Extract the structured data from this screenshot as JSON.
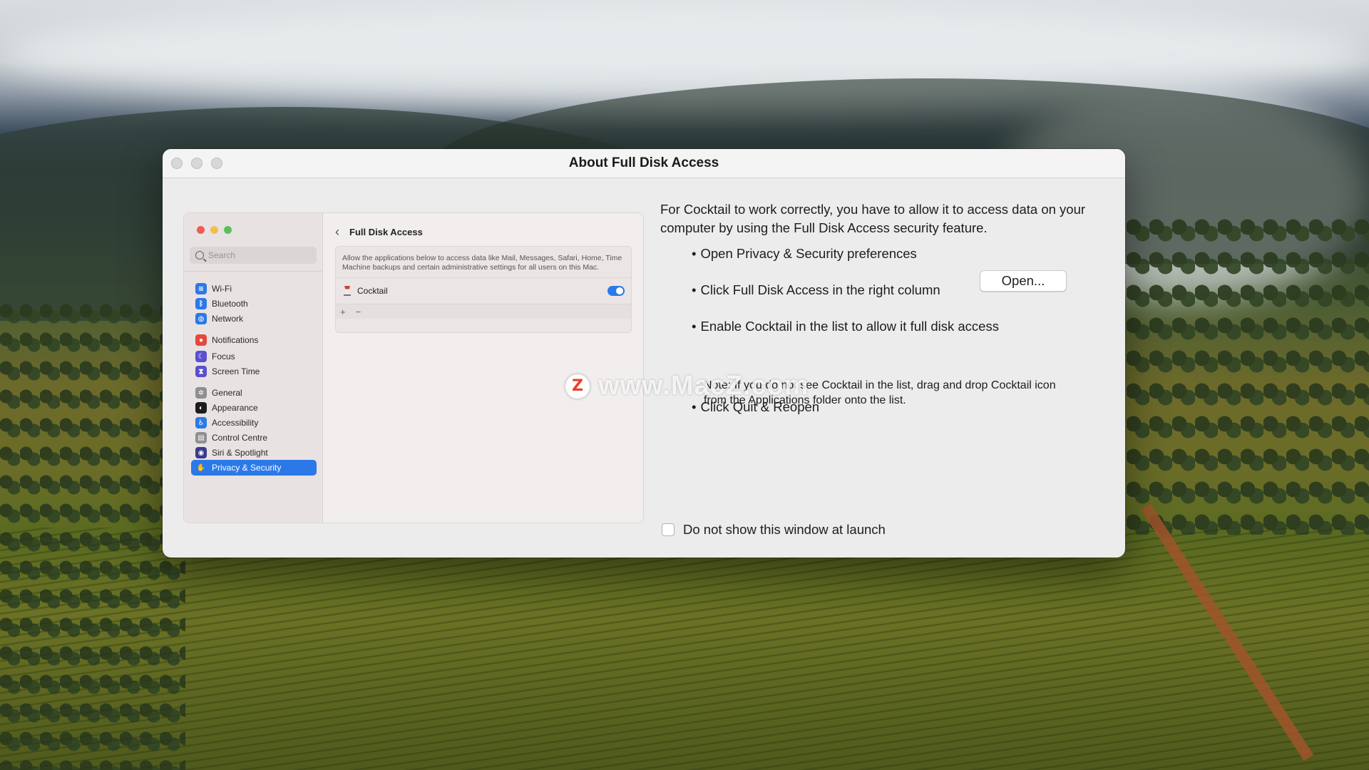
{
  "window": {
    "title": "About Full Disk Access"
  },
  "embedded_settings": {
    "search_placeholder": "Search",
    "header_title": "Full Disk Access",
    "panel_description": "Allow the applications below to access data like Mail, Messages, Safari, Home, Time Machine backups and certain administrative settings for all users on this Mac.",
    "app_row": {
      "name": "Cocktail",
      "enabled": true
    },
    "add_symbol": "+",
    "remove_symbol": "−",
    "sidebar": [
      {
        "label": "Wi-Fi",
        "icon": "wifi-icon",
        "color": "#2b79e8"
      },
      {
        "label": "Bluetooth",
        "icon": "bluetooth-icon",
        "color": "#2b79e8"
      },
      {
        "label": "Network",
        "icon": "globe-icon",
        "color": "#2b79e8"
      },
      {
        "label": "Notifications",
        "icon": "bell-icon",
        "color": "#e5483e"
      },
      {
        "label": "Focus",
        "icon": "moon-icon",
        "color": "#5a4fcf"
      },
      {
        "label": "Screen Time",
        "icon": "hourglass-icon",
        "color": "#5a4fcf"
      },
      {
        "label": "General",
        "icon": "gear-icon",
        "color": "#8e8e93"
      },
      {
        "label": "Appearance",
        "icon": "appearance-icon",
        "color": "#1c1c1e"
      },
      {
        "label": "Accessibility",
        "icon": "accessibility-icon",
        "color": "#2b79e8"
      },
      {
        "label": "Control Centre",
        "icon": "control-centre-icon",
        "color": "#8e8e93"
      },
      {
        "label": "Siri & Spotlight",
        "icon": "siri-icon",
        "color": "#3a3a8c"
      },
      {
        "label": "Privacy & Security",
        "icon": "hand-icon",
        "color": "#2b79e8",
        "selected": true
      }
    ]
  },
  "intro": "For Cocktail to work correctly, you have to allow it to access data on your computer by using the Full Disk Access security feature.",
  "steps": {
    "bullet": "•",
    "s1": "Open Privacy & Security preferences",
    "s2": "Click Full Disk Access in the right column",
    "s3": "Enable Cocktail in the list to allow it full disk access",
    "s4": "Click Quit & Reopen"
  },
  "note": "Note: If you do not see Cocktail in the list, drag and drop Cocktail icon from the Applications folder onto the list.",
  "open_button": "Open...",
  "checkbox": {
    "label": "Do not show this window at launch",
    "checked": false
  },
  "watermark": {
    "logo_letter": "Z",
    "text": "www.MacZ.com"
  },
  "colors": {
    "accent": "#2b79e8",
    "window_bg": "#ececec"
  }
}
